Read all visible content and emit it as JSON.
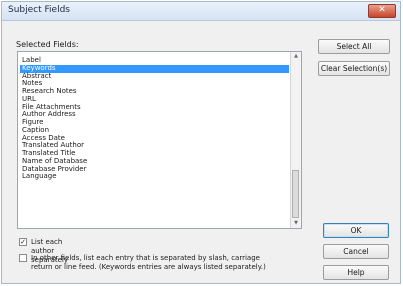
{
  "window": {
    "title": "Subject Fields",
    "close_glyph": "✕"
  },
  "list": {
    "label": "Selected Fields:",
    "items": [
      "Label",
      "Keywords",
      "Abstract",
      "Notes",
      "Research Notes",
      "URL",
      "File Attachments",
      "Author Address",
      "Figure",
      "Caption",
      "Access Date",
      "Translated Author",
      "Translated Title",
      "Name of Database",
      "Database Provider",
      "Language"
    ],
    "selected_index": 1
  },
  "buttons": {
    "select_all": "Select All",
    "clear_selection": "Clear Selection(s)",
    "ok": "OK",
    "cancel": "Cancel",
    "help": "Help"
  },
  "checkboxes": {
    "list_authors": {
      "label": "List each author separately",
      "checked": true
    },
    "other_fields": {
      "line1": "In other fields, list each entry that is separated by slash, carriage",
      "line2": "return or line feed.  (Keywords entries are always listed separately.)",
      "checked": false
    }
  },
  "colors": {
    "selection": "#3399ff",
    "close_button": "#c9442b"
  }
}
